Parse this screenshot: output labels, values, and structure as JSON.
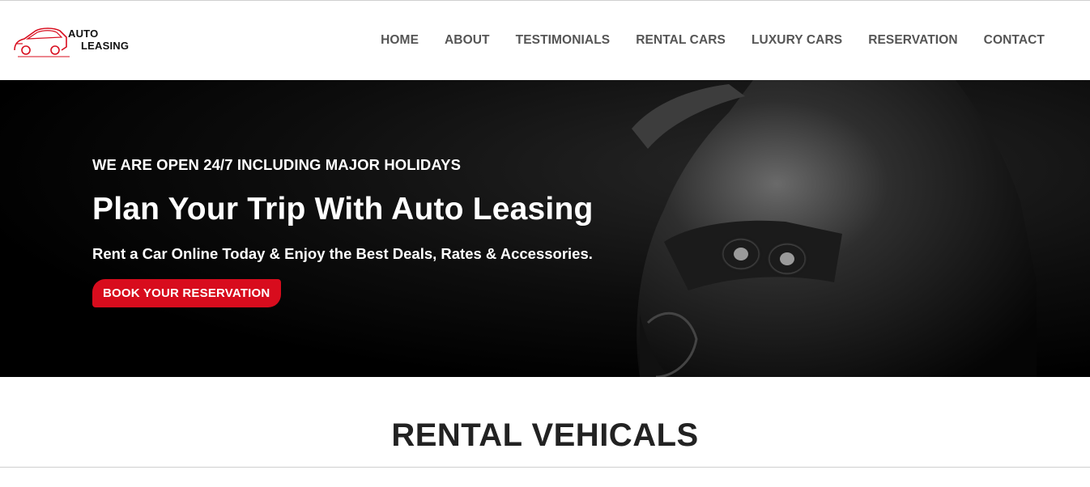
{
  "brand": {
    "line1": "AUTO",
    "line2": "LEASING",
    "accent": "#d80c1d"
  },
  "nav": {
    "items": [
      {
        "label": "HOME"
      },
      {
        "label": "ABOUT"
      },
      {
        "label": "TESTIMONIALS"
      },
      {
        "label": "RENTAL CARS"
      },
      {
        "label": "LUXURY CARS"
      },
      {
        "label": "RESERVATION"
      },
      {
        "label": "CONTACT"
      }
    ]
  },
  "hero": {
    "eyebrow": "WE ARE OPEN 24/7 INCLUDING MAJOR HOLIDAYS",
    "title": "Plan Your Trip With Auto Leasing",
    "subtitle": "Rent a Car Online Today & Enjoy the Best Deals, Rates & Accessories.",
    "cta_label": "BOOK YOUR RESERVATION"
  },
  "section": {
    "title": "RENTAL VEHICALS"
  }
}
